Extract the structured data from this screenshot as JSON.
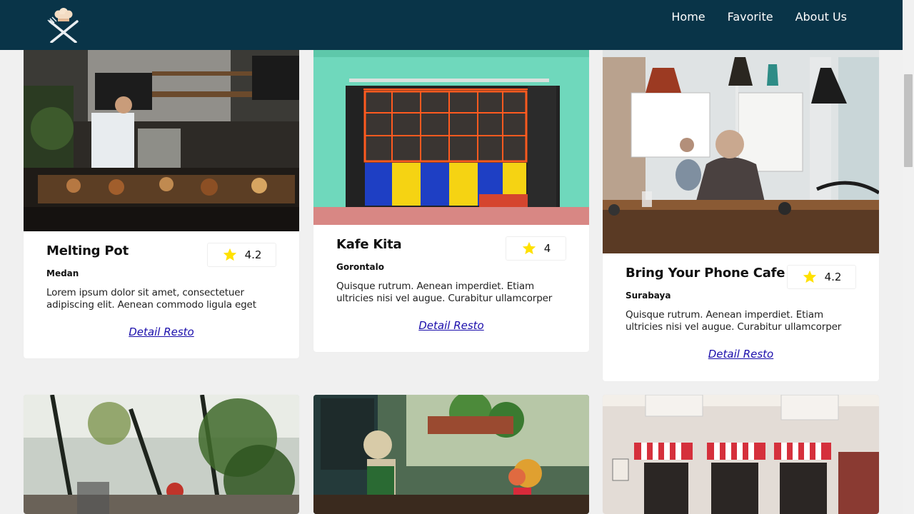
{
  "nav": {
    "logo_icon": "chef-hat-cutlery-icon",
    "links": [
      "Home",
      "Favorite",
      "About Us"
    ]
  },
  "cards": [
    {
      "name": "Melting Pot",
      "city": "Medan",
      "rating": "4.2",
      "description": "Lorem ipsum dolor sit amet, consectetuer adipiscing elit. Aenean commodo ligula eget dolor. Aenean…",
      "link": "Detail Resto",
      "image_scene": "coffee-bar-interior"
    },
    {
      "name": "Kafe Kita",
      "city": "Gorontalo",
      "rating": "4",
      "description": "Quisque rutrum. Aenean imperdiet. Etiam ultricies nisi vel augue. Curabitur ullamcorper ultricies nisi.…",
      "link": "Detail Resto",
      "image_scene": "colorful-shopfront"
    },
    {
      "name": "Bring Your Phone Cafe",
      "city": "Surabaya",
      "rating": "4.2",
      "description": "Quisque rutrum. Aenean imperdiet. Etiam ultricies nisi vel augue. Curabitur ullamcorper ultricies nisi.…",
      "link": "Detail Resto",
      "image_scene": "man-in-cafe"
    },
    {
      "image_scene": "greenhouse-cafe"
    },
    {
      "image_scene": "street-cafe-plants"
    },
    {
      "image_scene": "striped-awning-storefront"
    }
  ],
  "colors": {
    "navbar": "#093448",
    "background": "#f0f0f0",
    "star": "#ffe100",
    "link": "#1a0dab"
  }
}
